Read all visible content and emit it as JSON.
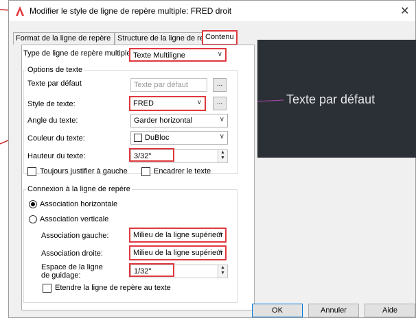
{
  "window": {
    "title": "Modifier le style de ligne de repère multiple: FRED droit",
    "close_symbol": "✕",
    "icon": "autocad-a-icon",
    "accent": "#e0383e"
  },
  "tabs": [
    {
      "label": "Format de la ligne de repère"
    },
    {
      "label": "Structure de la ligne de repère"
    },
    {
      "label": "Contenu"
    }
  ],
  "content": {
    "type_label": "Type de ligne de repère multiple:",
    "type_value": "Texte Multiligne",
    "text_options": {
      "group_title": "Options de texte",
      "default_text_label": "Texte par défaut",
      "default_text_value": "Texte par défaut",
      "browse_label": "...",
      "text_style_label": "Style de texte:",
      "text_style_value": "FRED",
      "text_angle_label": "Angle du texte:",
      "text_angle_value": "Garder horizontal",
      "text_color_label": "Couleur du texte:",
      "text_color_value": "DuBloc",
      "text_height_label": "Hauteur du texte:",
      "text_height_value": "3/32\"",
      "always_left_label": "Toujours justifier à gauche",
      "frame_text_label": "Encadrer le texte"
    },
    "connection": {
      "group_title": "Connexion à la ligne de repère",
      "horizontal_label": "Association horizontale",
      "vertical_label": "Association verticale",
      "left_label": "Association gauche:",
      "left_value": "Milieu de la ligne supérieur",
      "right_label": "Association droite:",
      "right_value": "Milieu de la ligne supérieur",
      "landing_gap_label_1": "Espace de la ligne",
      "landing_gap_label_2": "de guidage:",
      "landing_gap_value": "1/32\"",
      "extend_label": "Etendre la ligne de repère au texte"
    }
  },
  "preview": {
    "text": "Texte par défaut",
    "bg": "#2b2f36",
    "leader_color": "#b04ab0"
  },
  "buttons": {
    "ok": "OK",
    "cancel": "Annuler",
    "help": "Aide"
  }
}
